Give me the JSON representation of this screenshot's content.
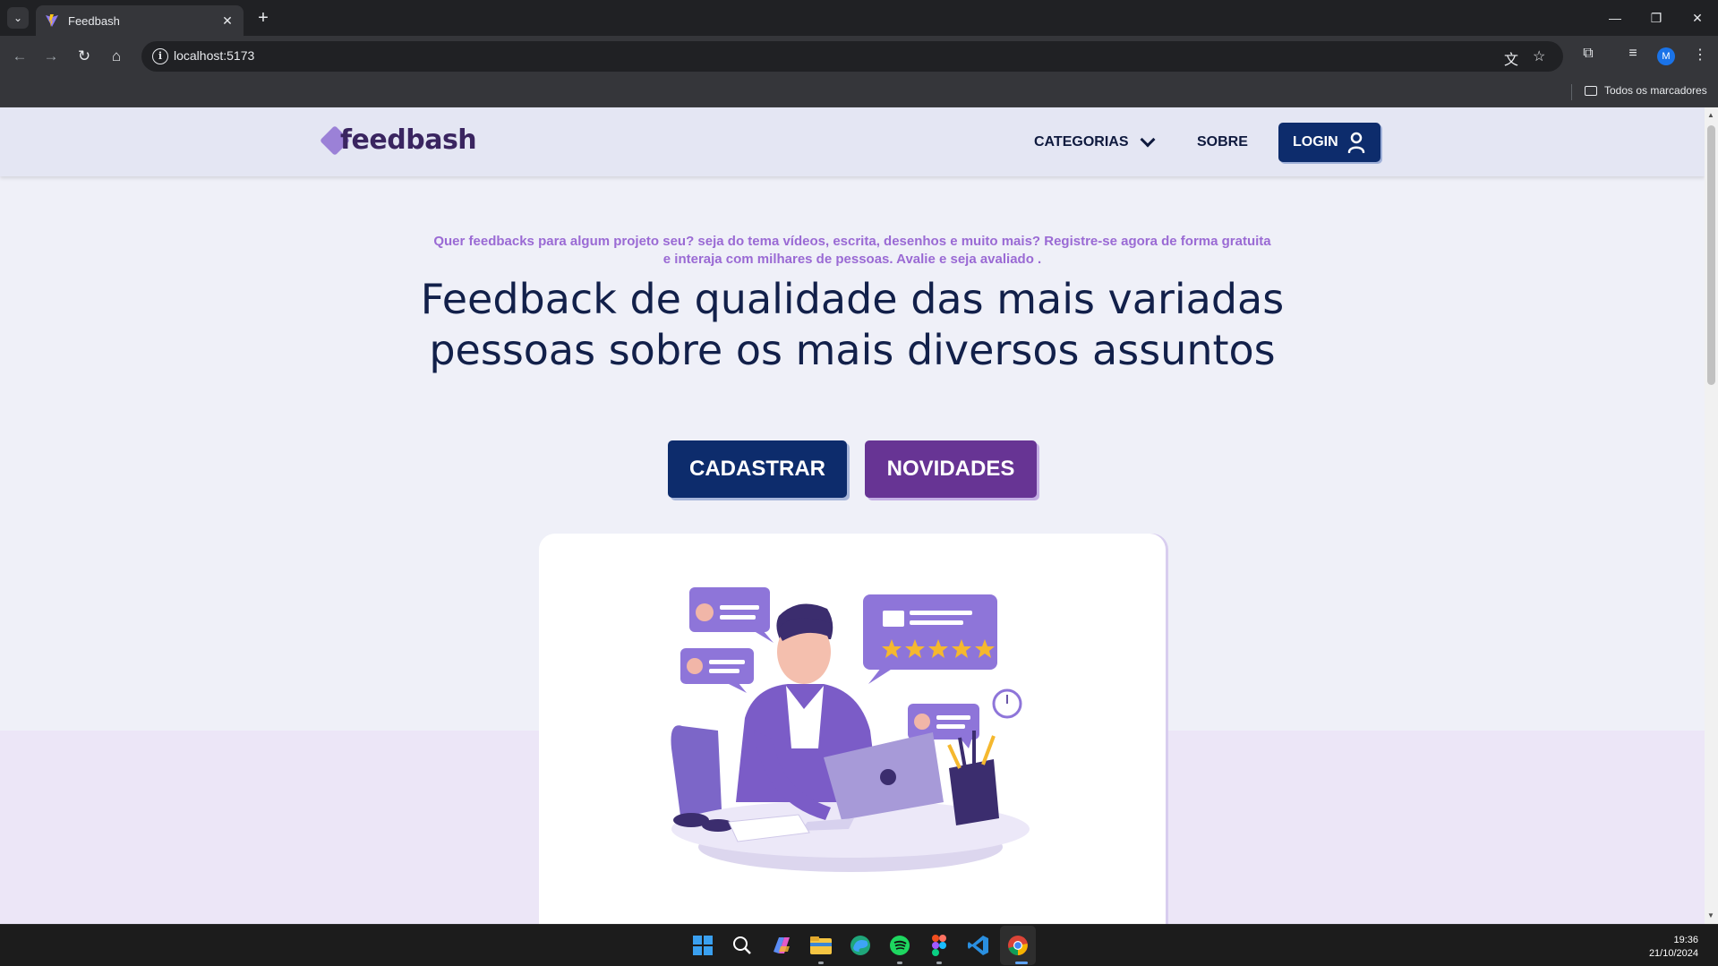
{
  "browser": {
    "tab_title": "Feedbash",
    "url": "localhost:5173",
    "bookmarks_all": "Todos os marcadores",
    "profile_initial": "M"
  },
  "site": {
    "logo": "feedbash",
    "nav": {
      "categories": "CATEGORIAS",
      "about": "SOBRE",
      "login": "LOGIN"
    },
    "hero": {
      "subtitle": "Quer feedbacks para algum projeto seu? seja do tema vídeos, escrita, desenhos e muito mais? Registre-se agora de forma gratuita e interaja com milhares de pessoas. Avalie e seja avaliado .",
      "headline": "Feedback de qualidade das mais variadas pessoas sobre os mais diversos assuntos",
      "cta_primary": "CADASTRAR",
      "cta_secondary": "NOVIDADES"
    },
    "colors": {
      "primary": "#0d2c6c",
      "secondary": "#673494",
      "accent_text": "#9a6ad4",
      "headline": "#12204a"
    }
  },
  "taskbar": {
    "time": "19:36",
    "date": "21/10/2024",
    "apps": [
      "start-icon",
      "search-icon",
      "copilot-icon",
      "file-explorer-icon",
      "edge-icon",
      "spotify-icon",
      "figma-icon",
      "vscode-icon",
      "chrome-icon"
    ]
  }
}
